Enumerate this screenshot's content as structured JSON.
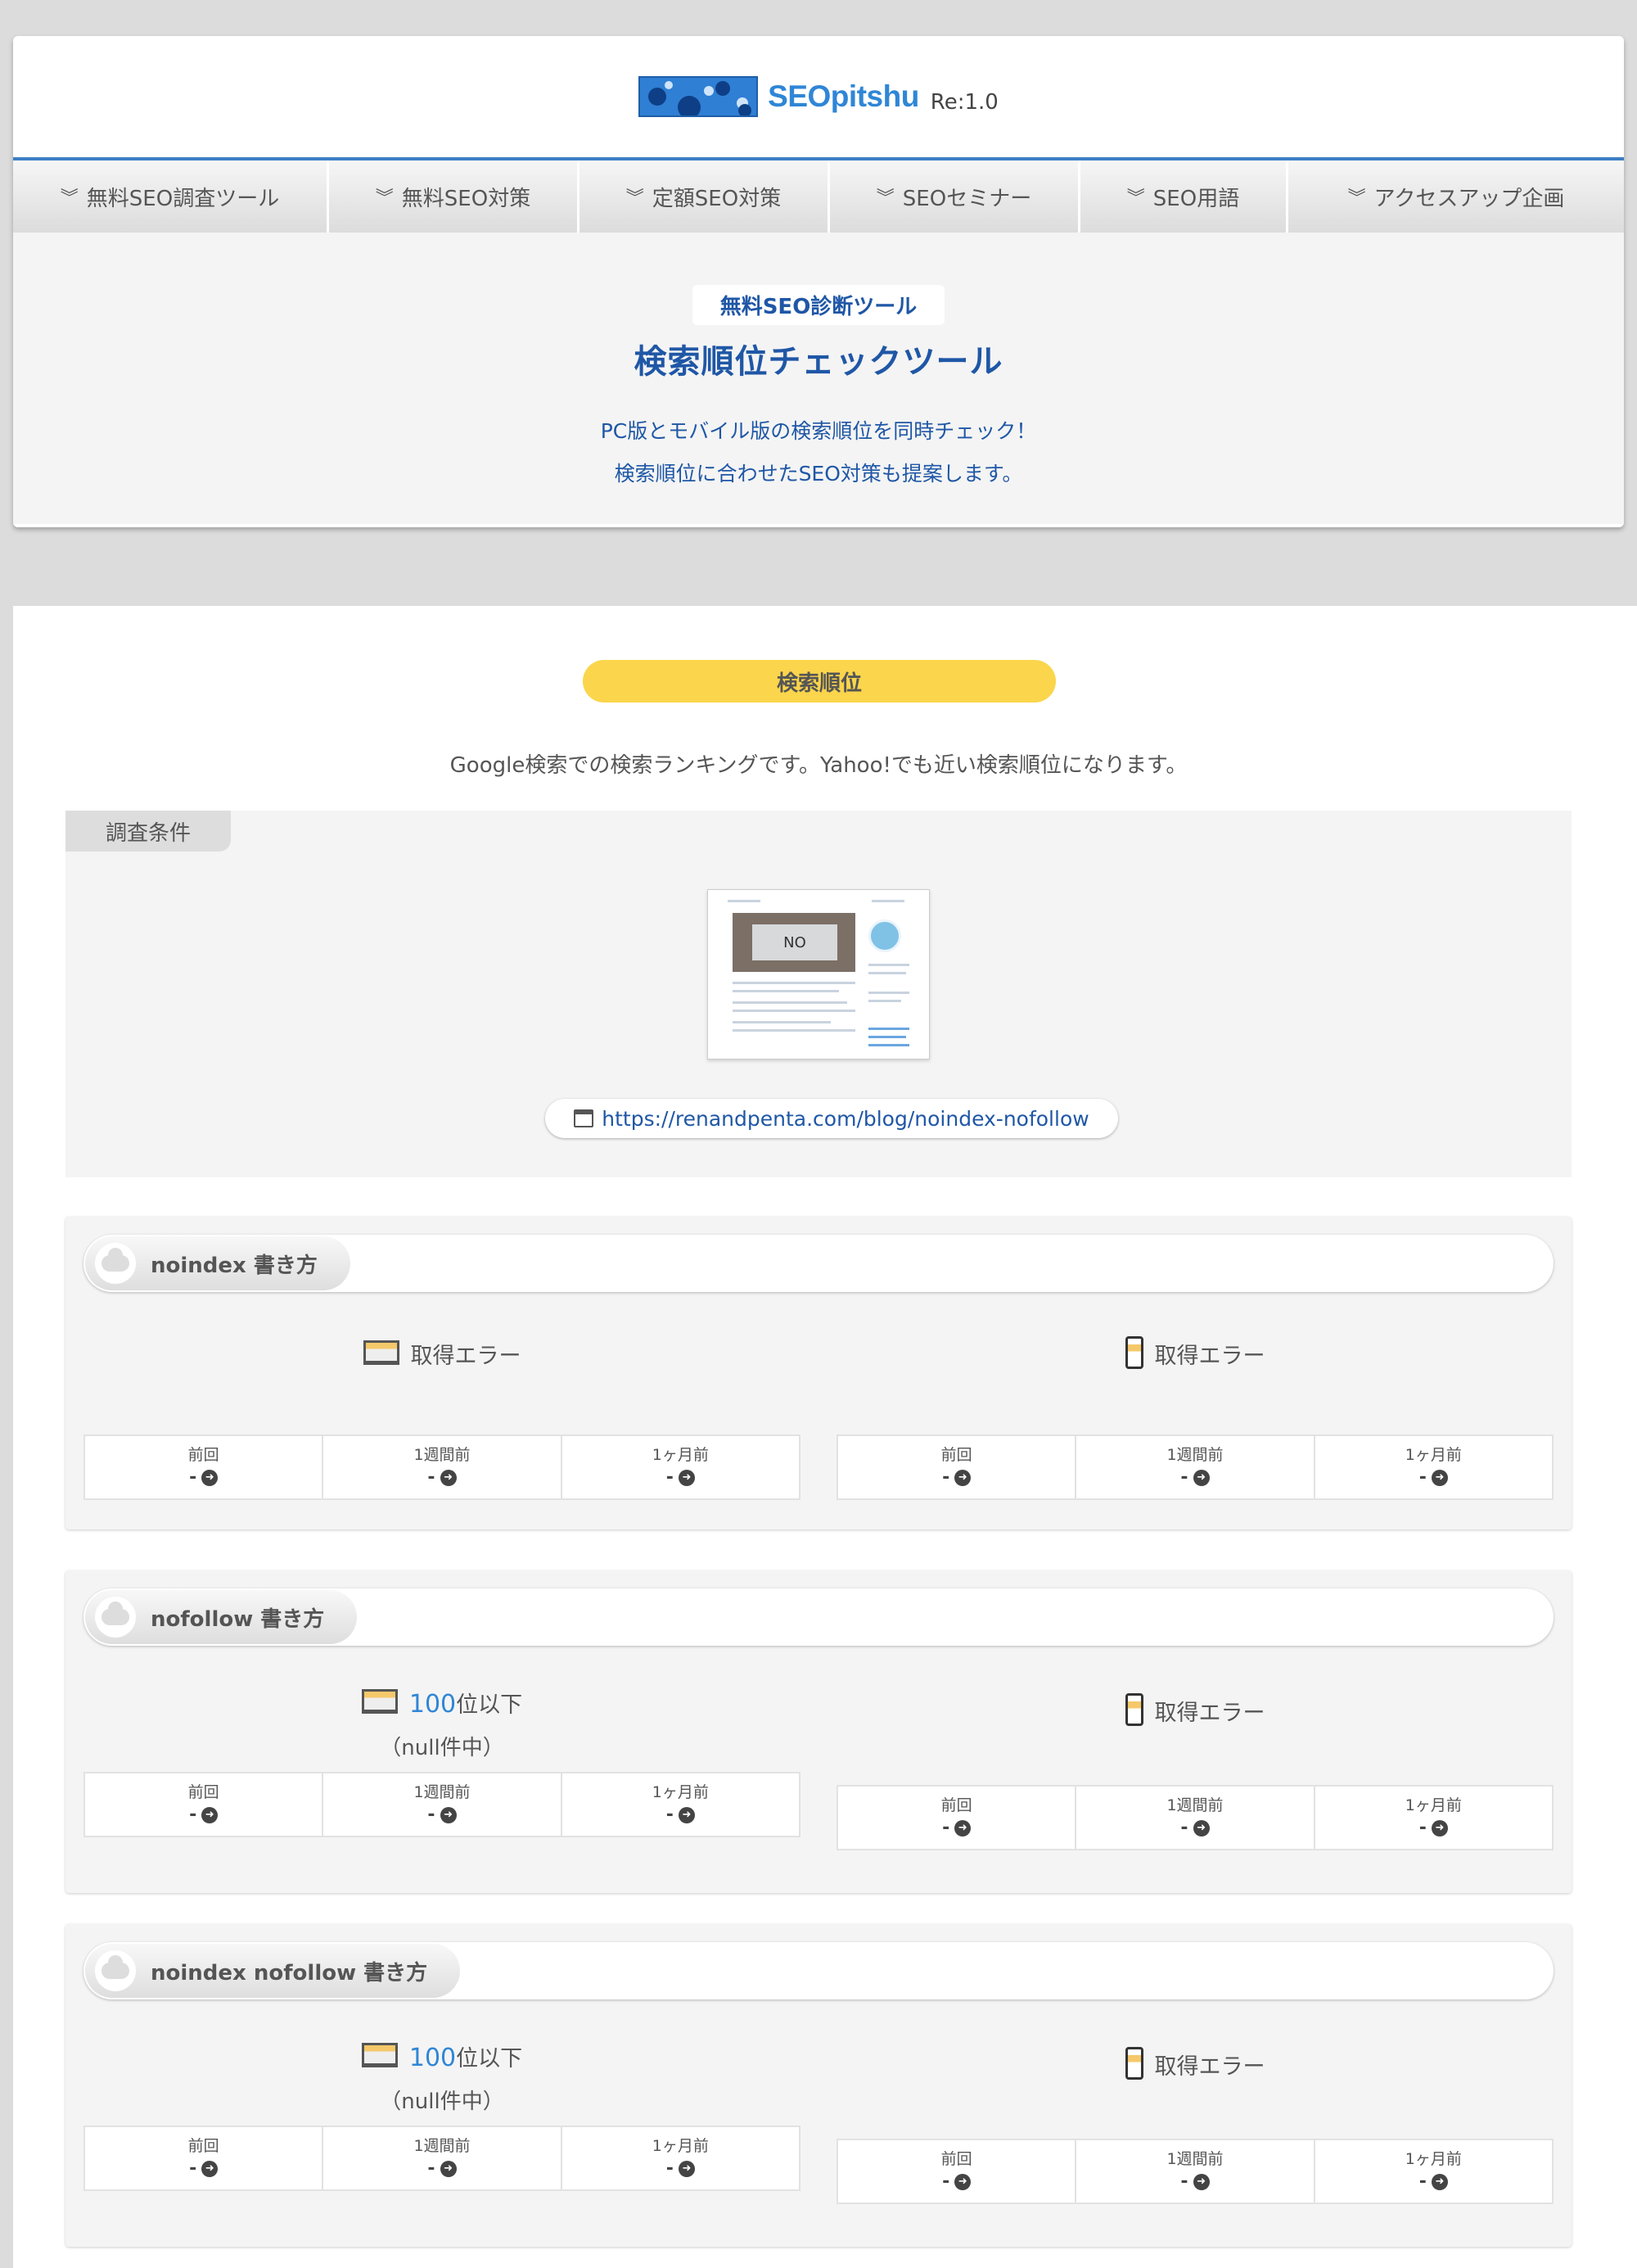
{
  "header": {
    "logo_text": "SEOpitshu",
    "version": "Re:1.0",
    "accent_color": "#3c7fc4"
  },
  "nav": {
    "items": [
      {
        "label": "無料SEO調査ツール"
      },
      {
        "label": "無料SEO対策"
      },
      {
        "label": "定額SEO対策"
      },
      {
        "label": "SEOセミナー"
      },
      {
        "label": "SEO用語"
      },
      {
        "label": "アクセスアップ企画"
      }
    ],
    "chevron_icon": "double-chevron-down-icon"
  },
  "hero": {
    "badge": "無料SEO診断ツール",
    "title": "検索順位チェックツール",
    "desc_line1": "PC版とモバイル版の検索順位を同時チェック！",
    "desc_line2": "検索順位に合わせたSEO対策も提案します。"
  },
  "main": {
    "section_title": "検索順位",
    "intro": "Google検索での検索ランキングです。Yahoo!でも近い検索順位になります。",
    "section_color": "#fbd54b",
    "conditions": {
      "tab": "調査条件",
      "thumb_sign": "NO",
      "url": "https://renandpenta.com/blog/noindex-nofollow"
    }
  },
  "history_labels": {
    "prev": "前回",
    "week": "1週間前",
    "month": "1ヶ月前"
  },
  "keywords": [
    {
      "keyword": "noindex 書き方",
      "pc": {
        "status": "取得エラー",
        "rank": "",
        "rank_suffix": "",
        "sub": ""
      },
      "sp": {
        "status": "取得エラー"
      },
      "pc_history": [
        "-",
        "-",
        "-"
      ],
      "sp_history": [
        "-",
        "-",
        "-"
      ]
    },
    {
      "keyword": "nofollow 書き方",
      "pc": {
        "status": "",
        "rank": "100",
        "rank_suffix": "位以下",
        "sub": "（null件中）"
      },
      "sp": {
        "status": "取得エラー"
      },
      "pc_history": [
        "-",
        "-",
        "-"
      ],
      "sp_history": [
        "-",
        "-",
        "-"
      ]
    },
    {
      "keyword": "noindex nofollow 書き方",
      "pc": {
        "status": "",
        "rank": "100",
        "rank_suffix": "位以下",
        "sub": "（null件中）"
      },
      "sp": {
        "status": "取得エラー"
      },
      "pc_history": [
        "-",
        "-",
        "-"
      ],
      "sp_history": [
        "-",
        "-",
        "-"
      ]
    }
  ]
}
